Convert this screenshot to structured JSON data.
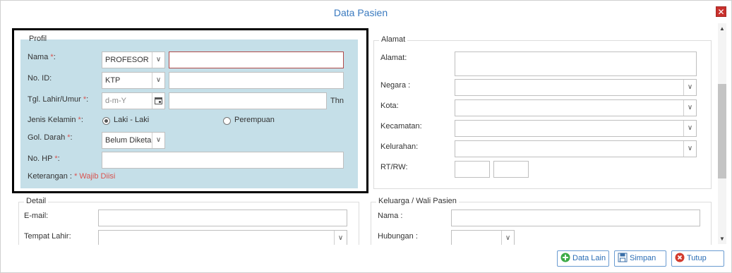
{
  "dialog": {
    "title": "Data Pasien",
    "close_icon": "close-icon"
  },
  "profil": {
    "legend": "Profil",
    "nama_label": "Nama ",
    "nama_prefix": "PROFESOR",
    "nama_value": "",
    "noid_label": "No. ID:",
    "noid_type": "KTP",
    "noid_value": "",
    "tgl_label": "Tgl. Lahir/Umur ",
    "tgl_placeholder": "d-m-Y",
    "umur_value": "",
    "thn_label": "Thn",
    "jk_label": "Jenis Kelamin ",
    "jk_option_1": "Laki - Laki",
    "jk_option_2": "Perempuan",
    "jk_selected": "Laki - Laki",
    "gol_label": "Gol. Darah ",
    "gol_value": "Belum Diketahui",
    "hp_label": "No. HP ",
    "hp_value": "",
    "required_mark": "*",
    "colon": ":",
    "keterangan_prefix": "Keterangan : ",
    "keterangan_required": "* Wajib Diisi"
  },
  "alamat": {
    "legend": "Alamat",
    "alamat_label": "Alamat:",
    "negara_label": "Negara :",
    "kota_label": "Kota:",
    "kecamatan_label": "Kecamatan:",
    "kelurahan_label": "Kelurahan:",
    "rtrw_label": "RT/RW:"
  },
  "detail": {
    "legend": "Detail",
    "email_label": "E-mail:",
    "tempat_lahir_label": "Tempat Lahir:"
  },
  "keluarga": {
    "legend": "Keluarga / Wali Pasien",
    "nama_label": "Nama :",
    "hubungan_label": "Hubungan :"
  },
  "buttons": {
    "data_lain": "Data Lain",
    "simpan": "Simpan",
    "tutup": "Tutup"
  },
  "colors": {
    "profil_bg": "#c5dfe8",
    "title": "#3a7abf",
    "required": "#d9534f",
    "close_bg": "#c9302c"
  }
}
